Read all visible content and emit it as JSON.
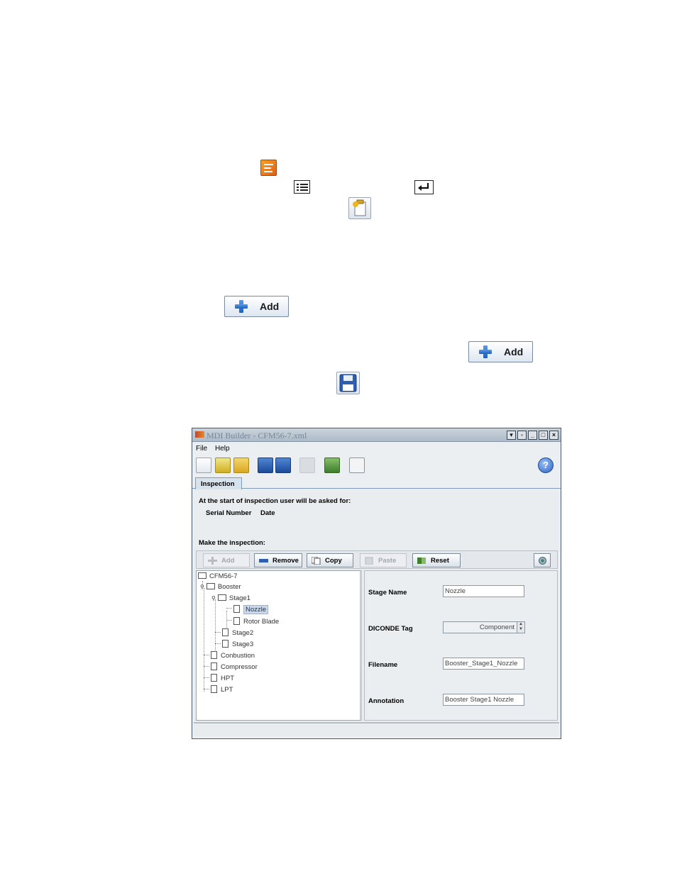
{
  "window": {
    "title": "MDI Builder - CFM56-7.xml"
  },
  "menu": {
    "file": "File",
    "help": "Help"
  },
  "tab": {
    "label": "Inspection"
  },
  "inspection": {
    "start_prompt": "At the start of inspection user will be asked for:",
    "ask_serial": "Serial Number",
    "ask_date": "Date",
    "make_label": "Make the inspection:"
  },
  "buttons": {
    "add": "Add",
    "remove": "Remove",
    "copy": "Copy",
    "paste": "Paste",
    "reset": "Reset"
  },
  "doc_buttons": {
    "add1": "Add",
    "add2": "Add"
  },
  "tree": {
    "root": "CFM56-7",
    "booster": "Booster",
    "stage1": "Stage1",
    "nozzle": "Nozzle",
    "rotor_blade": "Rotor Blade",
    "stage2": "Stage2",
    "stage3": "Stage3",
    "combustion": "Conbustion",
    "compressor": "Compressor",
    "hpt": "HPT",
    "lpt": "LPT"
  },
  "properties": {
    "stage_name_label": "Stage Name",
    "stage_name_value": "Nozzle",
    "diconde_label": "DICONDE Tag",
    "diconde_value": "Component",
    "filename_label": "Filename",
    "filename_value": "Booster_Stage1_Nozzle",
    "annotation_label": "Annotation",
    "annotation_value": "Booster Stage1 Nozzle"
  }
}
